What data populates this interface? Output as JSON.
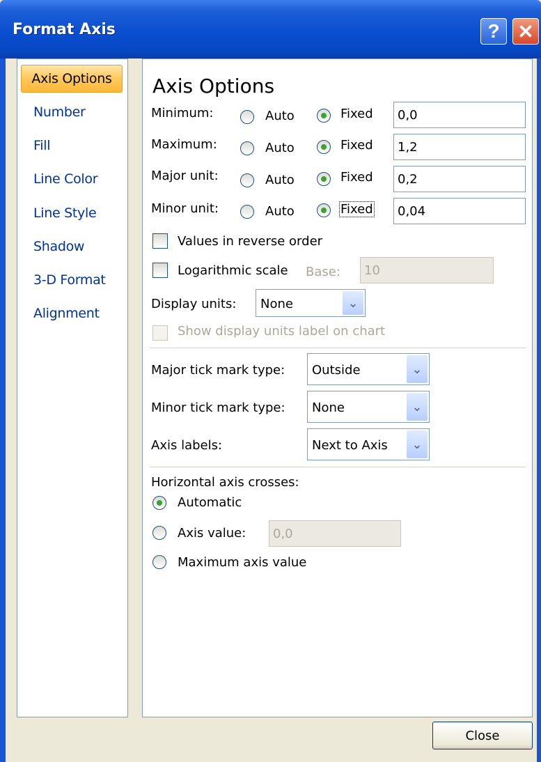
{
  "window": {
    "title": "Format Axis",
    "help_glyph": "?",
    "close_glyph": "✕"
  },
  "nav": {
    "items": [
      "Axis Options",
      "Number",
      "Fill",
      "Line Color",
      "Line Style",
      "Shadow",
      "3-D Format",
      "Alignment"
    ],
    "selected": "Axis Options"
  },
  "section": {
    "title": "Axis Options"
  },
  "bounds": {
    "auto_label": "Auto",
    "fixed_label": "Fixed",
    "rows": [
      {
        "label": "Minimum:",
        "mode": "Fixed",
        "value": "0,0"
      },
      {
        "label": "Maximum:",
        "mode": "Fixed",
        "value": "1,2"
      },
      {
        "label": "Major unit:",
        "mode": "Fixed",
        "value": "0,2"
      },
      {
        "label": "Minor unit:",
        "mode": "Fixed",
        "value": "0,04"
      }
    ]
  },
  "options": {
    "reverse_label": "Values in reverse order",
    "reverse_checked": false,
    "log_label": "Logarithmic scale",
    "log_checked": false,
    "base_label": "Base:",
    "base_value": "10",
    "display_units_label": "Display units:",
    "display_units_value": "None",
    "show_units_label": "Show display units label on chart",
    "show_units_checked": false
  },
  "ticks": {
    "major_label": "Major tick mark type:",
    "major_value": "Outside",
    "minor_label": "Minor tick mark type:",
    "minor_value": "None",
    "axis_labels_label": "Axis labels:",
    "axis_labels_value": "Next to Axis"
  },
  "crosses": {
    "heading": "Horizontal axis crosses:",
    "automatic_label": "Automatic",
    "axis_value_label": "Axis value:",
    "axis_value": "0,0",
    "max_label": "Maximum axis value",
    "selected": "Automatic"
  },
  "footer": {
    "close_label": "Close"
  },
  "colors": {
    "titlebar": "#0a4fd0",
    "nav_selected": "#ffc85a",
    "radio_on": "#3aa331"
  }
}
